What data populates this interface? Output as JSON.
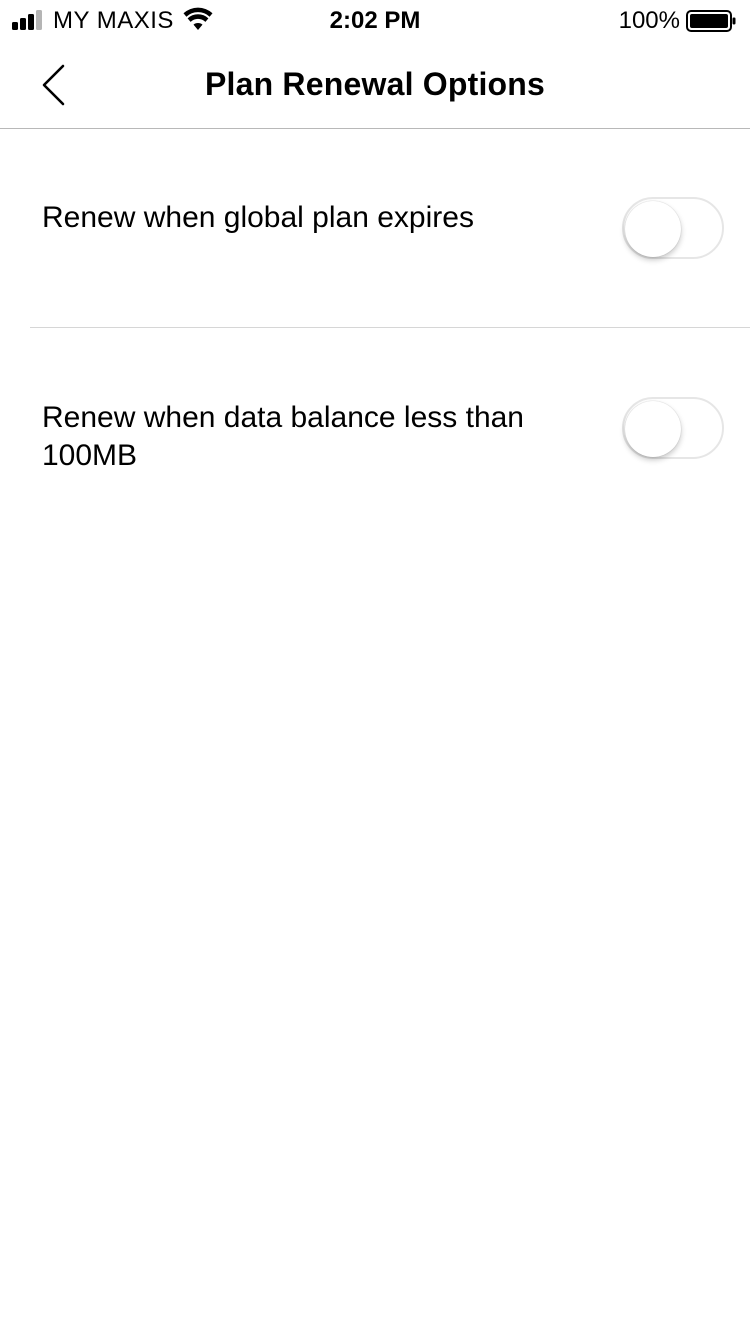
{
  "status_bar": {
    "carrier": "MY MAXIS",
    "time": "2:02 PM",
    "battery_percent": "100%"
  },
  "nav": {
    "title": "Plan Renewal Options",
    "back_icon": "chevron-left-icon"
  },
  "options": [
    {
      "label": "Renew when global plan expires",
      "enabled": false
    },
    {
      "label": "Renew when data balance less than 100MB",
      "enabled": false
    }
  ],
  "colors": {
    "divider": "#d6d6d6",
    "nav_border": "#b8b8b8",
    "toggle_border": "#e6e6e6",
    "background": "#ffffff"
  }
}
